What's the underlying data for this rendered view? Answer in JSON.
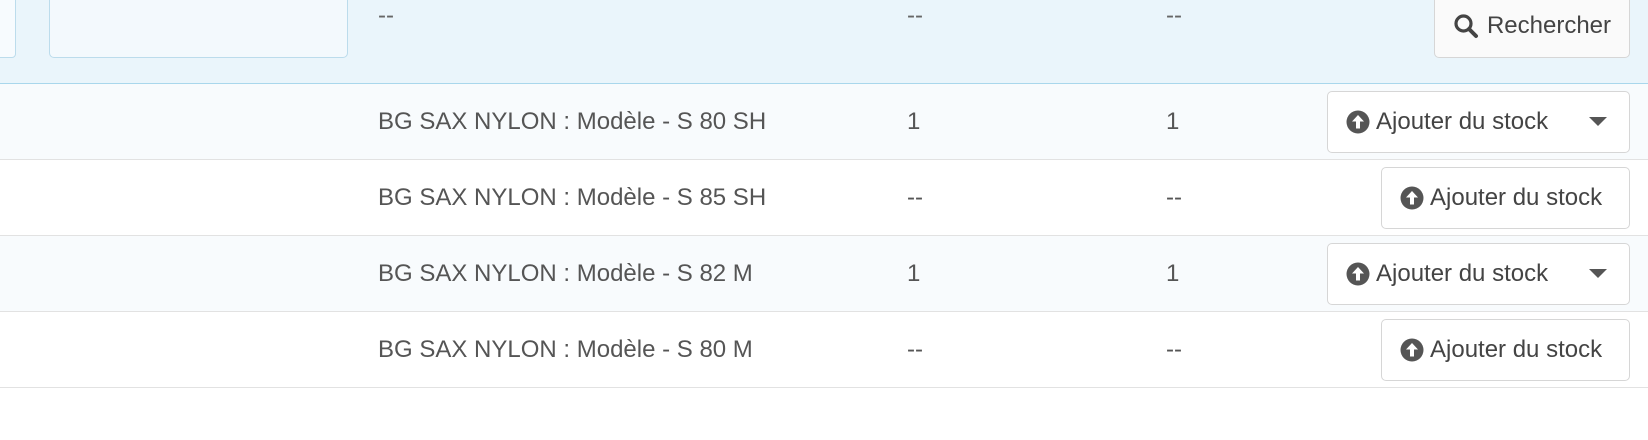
{
  "filters": {
    "name_placeholder": "--",
    "qty1_placeholder": "--",
    "qty2_placeholder": "--",
    "search_label": "Rechercher"
  },
  "rows": [
    {
      "name": "BG SAX NYLON : Modèle - S 80 SH",
      "qty1": "1",
      "qty2": "1",
      "action_label": "Ajouter du stock",
      "has_dropdown": true
    },
    {
      "name": "BG SAX NYLON : Modèle - S 85 SH",
      "qty1": "--",
      "qty2": "--",
      "action_label": "Ajouter du stock",
      "has_dropdown": false
    },
    {
      "name": "BG SAX NYLON : Modèle - S 82 M",
      "qty1": "1",
      "qty2": "1",
      "action_label": "Ajouter du stock",
      "has_dropdown": true
    },
    {
      "name": "BG SAX NYLON : Modèle - S 80 M",
      "qty1": "--",
      "qty2": "--",
      "action_label": "Ajouter du stock",
      "has_dropdown": false
    }
  ],
  "icons": {
    "search": "search-icon",
    "upload": "arrow-circle-up-icon",
    "dropdown": "caret-down-icon"
  },
  "colors": {
    "filter_bg": "#eaf5fb",
    "filter_border": "#a9d7ec",
    "text": "#555555"
  }
}
